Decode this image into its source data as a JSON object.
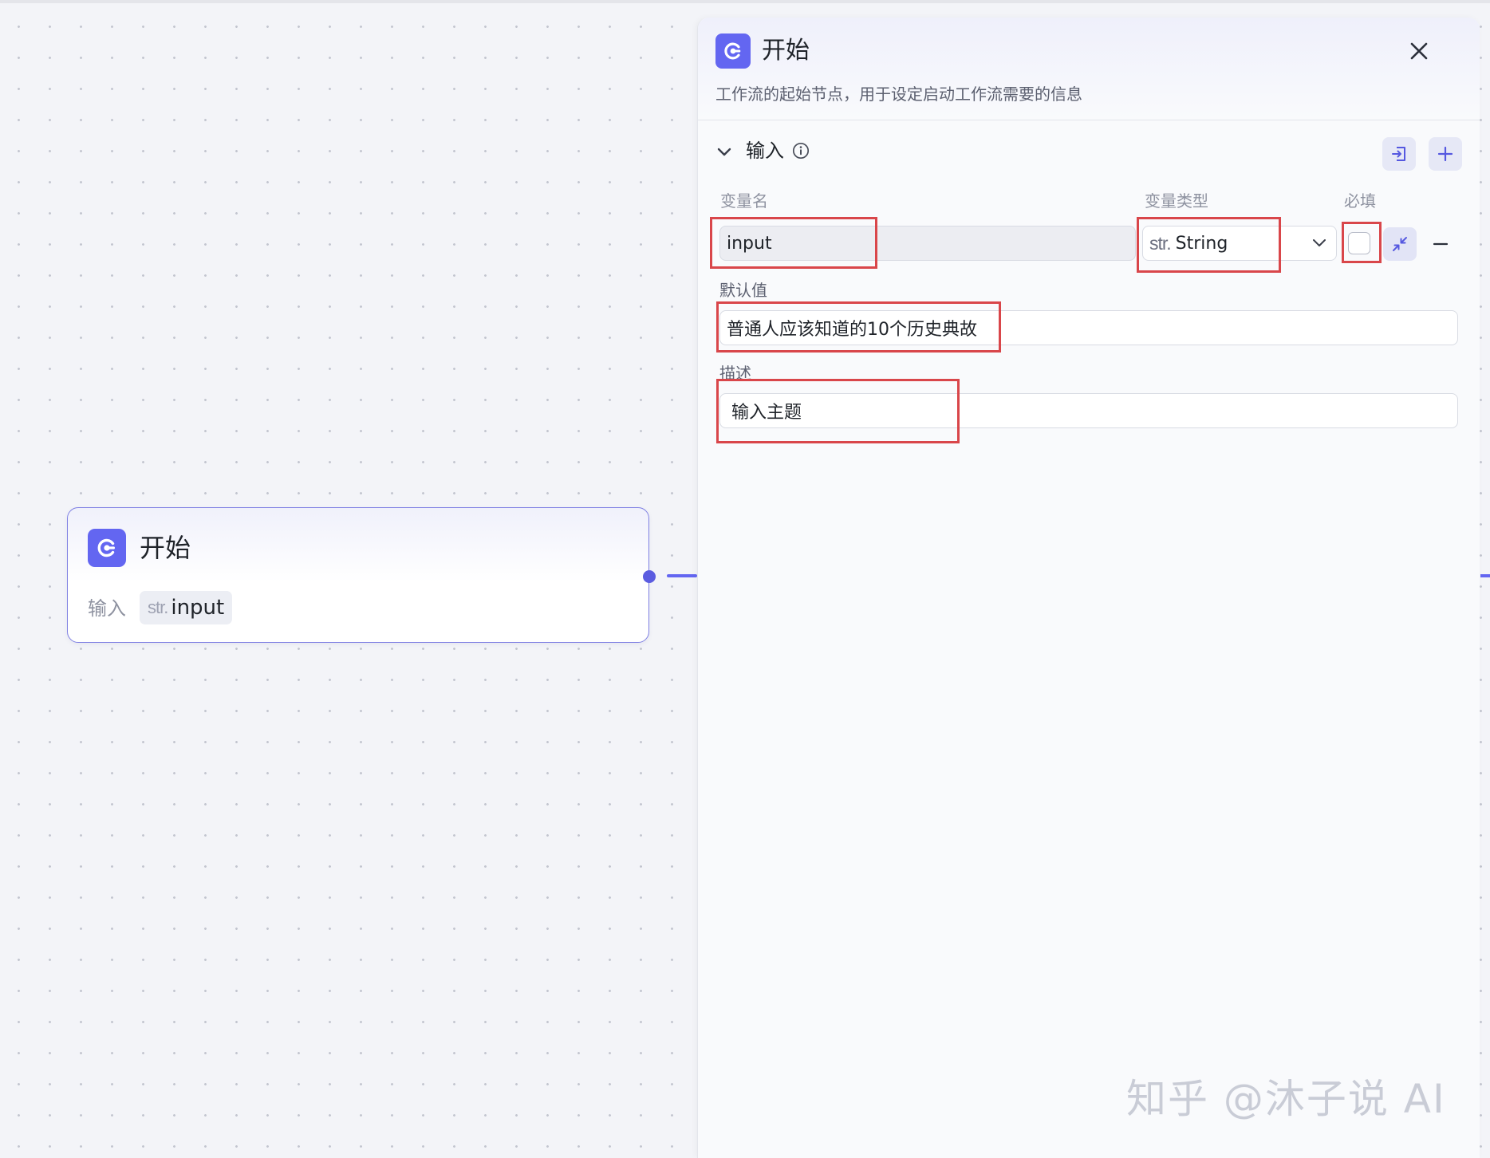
{
  "canvas": {
    "node": {
      "title": "开始",
      "input_label": "输入",
      "var_type": "str.",
      "var_name": "input"
    }
  },
  "panel": {
    "title": "开始",
    "description": "工作流的起始节点，用于设定启动工作流需要的信息",
    "section": {
      "title": "输入"
    },
    "columns": {
      "name": "变量名",
      "type": "变量类型",
      "required": "必填"
    },
    "variable": {
      "name": "input",
      "type_prefix": "str.",
      "type": "String",
      "required": false,
      "default_label": "默认值",
      "default_value": "普通人应该知道的10个历史典故",
      "desc_label": "描述",
      "desc_value": "输入主题"
    }
  },
  "watermark": "知乎 @沐子说 AI",
  "colors": {
    "accent": "#6366f1",
    "annotation": "#d9464a"
  }
}
